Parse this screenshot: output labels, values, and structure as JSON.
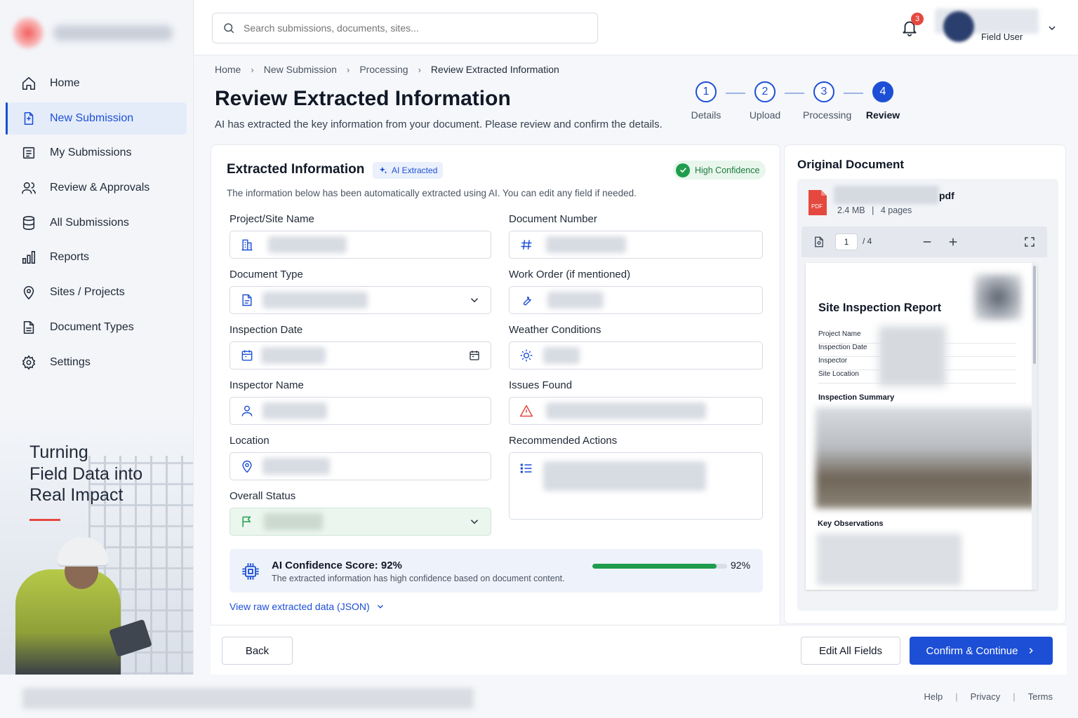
{
  "sidebar": {
    "items": [
      {
        "label": "Home",
        "icon": "home-icon"
      },
      {
        "label": "New Submission",
        "icon": "document-plus-icon",
        "active": true
      },
      {
        "label": "My Submissions",
        "icon": "list-icon"
      },
      {
        "label": "Review & Approvals",
        "icon": "users-icon"
      },
      {
        "label": "All Submissions",
        "icon": "database-icon"
      },
      {
        "label": "Reports",
        "icon": "bar-chart-icon"
      },
      {
        "label": "Sites / Projects",
        "icon": "map-pin-icon"
      },
      {
        "label": "Document Types",
        "icon": "document-icon"
      },
      {
        "label": "Settings",
        "icon": "gear-icon"
      }
    ],
    "promo": {
      "line1": "Turning",
      "line2": "Field Data into",
      "line3": "Real Impact"
    }
  },
  "topbar": {
    "search_placeholder": "Search submissions, documents, sites...",
    "notification_count": "3",
    "user_role": "Field User"
  },
  "breadcrumb": [
    "Home",
    "New Submission",
    "Processing",
    "Review Extracted Information"
  ],
  "page": {
    "title": "Review Extracted Information",
    "subtitle": "AI has extracted the key information from your document. Please review and confirm the details."
  },
  "stepper": [
    {
      "num": "1",
      "label": "Details"
    },
    {
      "num": "2",
      "label": "Upload"
    },
    {
      "num": "3",
      "label": "Processing"
    },
    {
      "num": "4",
      "label": "Review",
      "active": true
    }
  ],
  "extracted": {
    "title": "Extracted Information",
    "ai_tag": "AI Extracted",
    "confidence_tag": "High Confidence",
    "description": "The information below has been automatically extracted using AI. You can edit any field if needed.",
    "fields": {
      "project_site_name": "Project/Site Name",
      "document_number": "Document Number",
      "document_type": "Document Type",
      "work_order": "Work Order (if mentioned)",
      "inspection_date": "Inspection Date",
      "weather_conditions": "Weather Conditions",
      "inspector_name": "Inspector Name",
      "issues_found": "Issues Found",
      "location": "Location",
      "recommended_actions": "Recommended Actions",
      "overall_status": "Overall Status"
    },
    "score_title": "AI Confidence Score: 92%",
    "score_desc": "The extracted information has high confidence based on document content.",
    "score_value": 0.92,
    "score_pct": "92%",
    "raw_link": "View raw extracted data (JSON)"
  },
  "document": {
    "title": "Original Document",
    "file_ext": "pdf",
    "file_size": "2.4 MB",
    "meta_sep": "|",
    "pages": "4 pages",
    "current_page": "1",
    "total_pages": "/ 4",
    "preview": {
      "title": "Site Inspection Report",
      "rows": [
        "Project Name",
        "Inspection Date",
        "Inspector",
        "Site Location"
      ],
      "summary_heading": "Inspection Summary",
      "observations_heading": "Key Observations"
    }
  },
  "actions": {
    "back": "Back",
    "edit_all": "Edit All Fields",
    "confirm": "Confirm & Continue"
  },
  "footer": {
    "links": [
      "Help",
      "Privacy",
      "Terms"
    ],
    "sep": "|"
  },
  "colors": {
    "primary": "#1d4fd6",
    "success": "#1f9d4c",
    "danger": "#e5483f"
  }
}
